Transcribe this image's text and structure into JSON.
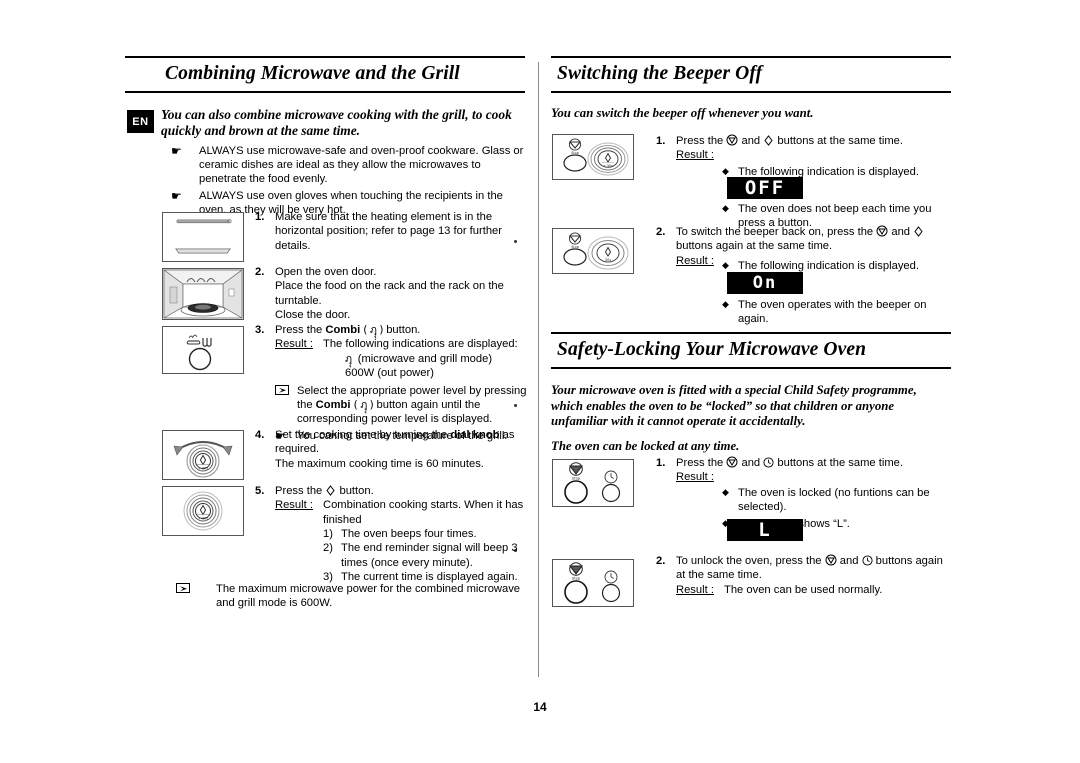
{
  "document": {
    "page_number": "14",
    "language_badge": "EN"
  },
  "left": {
    "heading": "Combining Microwave and the Grill",
    "intro": "You can also combine microwave cooking with the grill, to cook quickly and brown at the same time.",
    "notes": [
      "ALWAYS use microwave-safe and oven-proof cookware. Glass or ceramic dishes are ideal as they allow the microwaves to penetrate the food evenly.",
      "ALWAYS use oven gloves when touching the recipients in the oven, as they will be very hot."
    ],
    "steps": [
      {
        "num": "1.",
        "text": "Make sure that the heating element is in the horizontal position; refer to page 13 for further details.",
        "illustration": "heating-element-horizontal"
      },
      {
        "num": "2.",
        "lines": [
          "Open the oven door.",
          "Place the food on the rack and the rack on the turntable.",
          "Close the door."
        ],
        "illustration": "oven-interior-rack"
      },
      {
        "num": "3.",
        "text_pre": "Press the ",
        "text_bold": "Combi",
        "text_glyph": "( ฦุุ )",
        "text_post": " button.",
        "result_label": "Result :",
        "result_text": "The following indications are displayed:",
        "result_sub1": "(microwave and grill mode)",
        "result_sub2": "600W (out power)",
        "mw_note_pre": "Select the appropriate power level by pressing the ",
        "mw_note_bold": "Combi",
        "mw_note_post": " button again until the corresponding power level is displayed.",
        "hand_note": "You cannot set the temperature of the grill.",
        "illustration": "combi-button"
      },
      {
        "num": "4.",
        "text_pre": "Set the cooking time by turning the ",
        "text_bold": "dial knob",
        "text_post": " as required.",
        "text_line2": "The maximum cooking time is 60 minutes.",
        "illustration": "dial-knob-turn"
      },
      {
        "num": "5.",
        "text_pre": "Press the ",
        "text_post": " button.",
        "result_label": "Result :",
        "result_text": "Combination cooking starts. When it has finished",
        "sub_items": [
          {
            "num": "1)",
            "text": "The oven beeps four times."
          },
          {
            "num": "2)",
            "text": "The end reminder signal will beep 3 times (once every minute)."
          },
          {
            "num": "3)",
            "text": "The current time is displayed again."
          }
        ],
        "illustration": "start-button"
      }
    ],
    "footer_note": "The maximum microwave power for the combined microwave and grill mode is 600W."
  },
  "right": {
    "beeper": {
      "heading": "Switching the Beeper Off",
      "intro": "You can switch the beeper off whenever you want.",
      "steps": [
        {
          "num": "1.",
          "text_pre": "Press the ",
          "text_mid": " and ",
          "text_post": " buttons at the same time.",
          "result_label": "Result :",
          "bullets_before": "The following indication is displayed.",
          "display": "OFF",
          "bullets_after": "The oven does not beep each time you press a button.",
          "illustration": "stop-and-start-buttons"
        },
        {
          "num": "2.",
          "text_pre": "To switch the beeper back on, press the ",
          "text_mid": " and ",
          "text_post": " buttons again at the same time.",
          "result_label": "Result :",
          "bullets_before": "The following indication is displayed.",
          "display": "On",
          "bullets_after": "The oven operates with the beeper on again.",
          "illustration": "stop-and-start-buttons"
        }
      ]
    },
    "safety": {
      "heading": "Safety-Locking Your Microwave Oven",
      "intro1": "Your microwave oven is fitted with a special Child Safety programme, which enables the oven to be “locked” so that children or anyone unfamiliar with it cannot operate it accidentally.",
      "intro2": "The oven can be locked at any time.",
      "steps": [
        {
          "num": "1.",
          "text_pre": "Press the ",
          "text_mid": " and ",
          "text_post": " buttons at the same time.",
          "result_label": "Result :",
          "bullet1": "The oven is locked (no funtions can be selected).",
          "bullet2": "The display shows “L”.",
          "display": "L",
          "illustration": "stop-and-clock-buttons"
        },
        {
          "num": "2.",
          "text_pre": "To unlock the oven, press the ",
          "text_mid": " and ",
          "text_post": " buttons again at the same time.",
          "result_label": "Result :",
          "result_text": "The oven can be used normally.",
          "illustration": "stop-and-clock-buttons"
        }
      ]
    }
  },
  "icons": {
    "hand": "☛",
    "diamond": "◆",
    "microwave": "microwave-icon",
    "stop": "stop-button-icon",
    "start": "start-button-icon",
    "clock": "clock-button-icon"
  }
}
